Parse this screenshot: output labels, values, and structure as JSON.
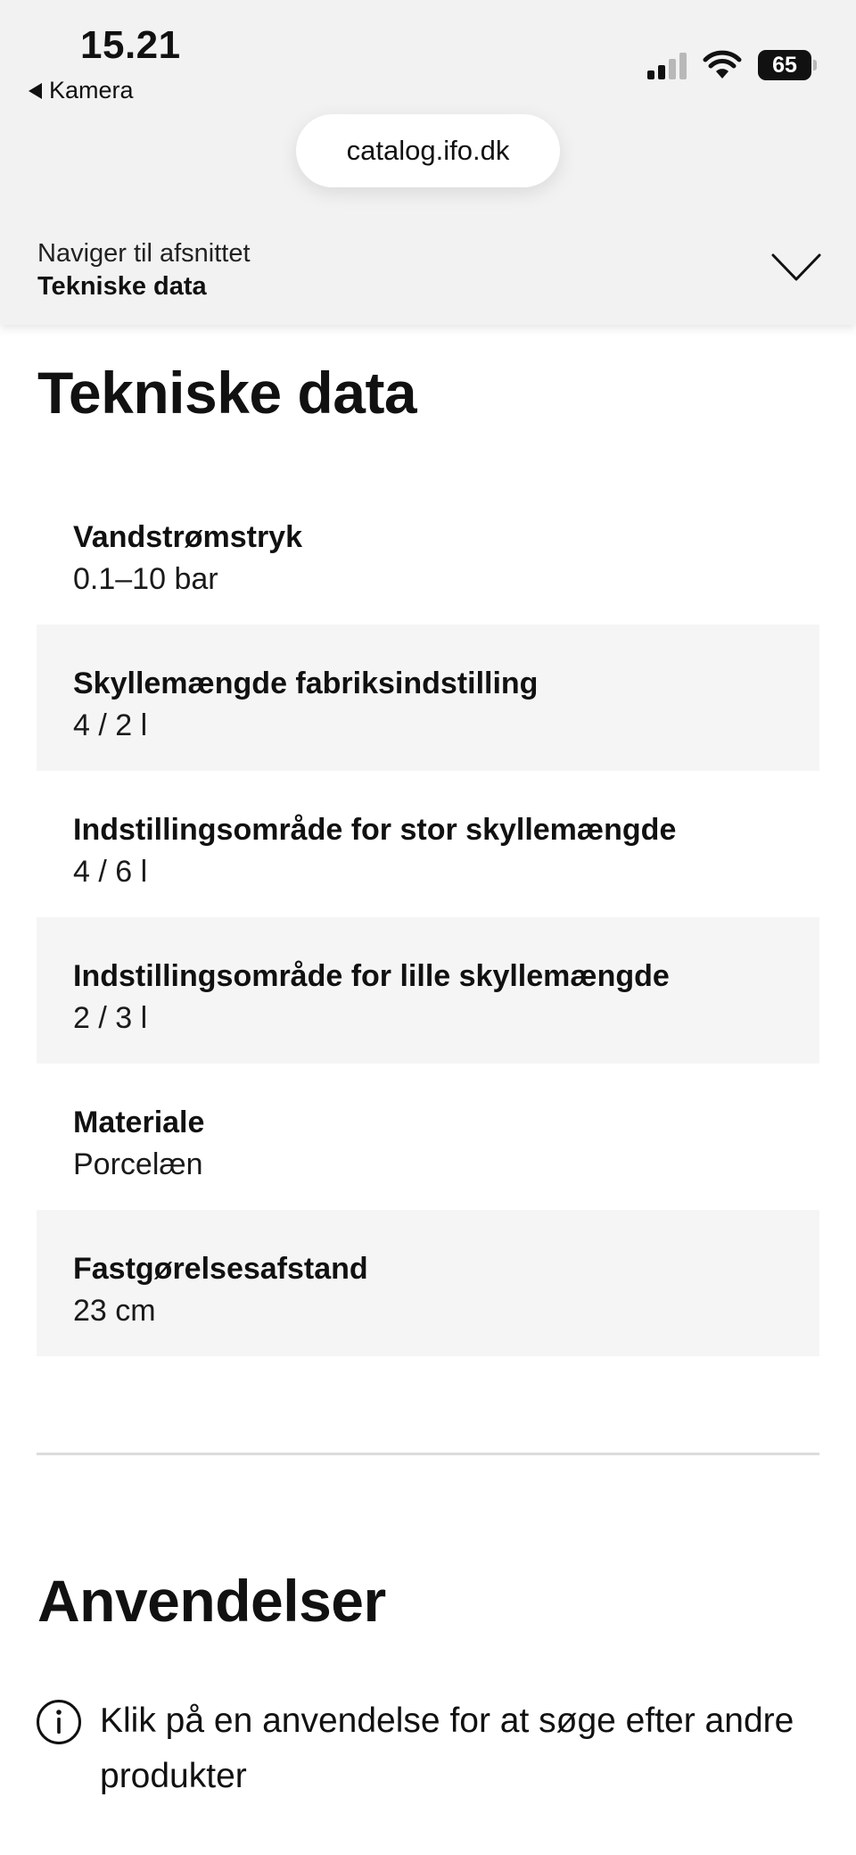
{
  "status_bar": {
    "time": "15.21",
    "back_app": "Kamera",
    "battery": "65"
  },
  "browser": {
    "url": "catalog.ifo.dk"
  },
  "section_nav": {
    "caption": "Naviger til afsnittet",
    "current": "Tekniske data"
  },
  "technical_data": {
    "title": "Tekniske data",
    "rows": [
      {
        "label": "Vandstrømstryk",
        "value": "0.1–10 bar"
      },
      {
        "label": "Skyllemængde fabriksindstilling",
        "value": "4 / 2 l"
      },
      {
        "label": "Indstillingsområde for stor skyllemængde",
        "value": "4 / 6 l"
      },
      {
        "label": "Indstillingsområde for lille skyllemængde",
        "value": "2 / 3 l"
      },
      {
        "label": "Materiale",
        "value": "Porcelæn"
      },
      {
        "label": "Fastgørelsesafstand",
        "value": "23 cm"
      }
    ]
  },
  "applications": {
    "title": "Anvendelser",
    "info_text": "Klik på en anvendelse for at søge efter andre produkter"
  },
  "icons": {
    "back": "back-triangle-icon",
    "signal": "cellular-signal-icon",
    "wifi": "wifi-icon",
    "battery": "battery-icon",
    "chevron": "chevron-down-icon",
    "info": "info-icon"
  },
  "colors": {
    "topbar_bg": "#f2f2f2",
    "row_alt_bg": "#f5f5f5",
    "divider": "#dcdcdc",
    "text": "#111111"
  }
}
